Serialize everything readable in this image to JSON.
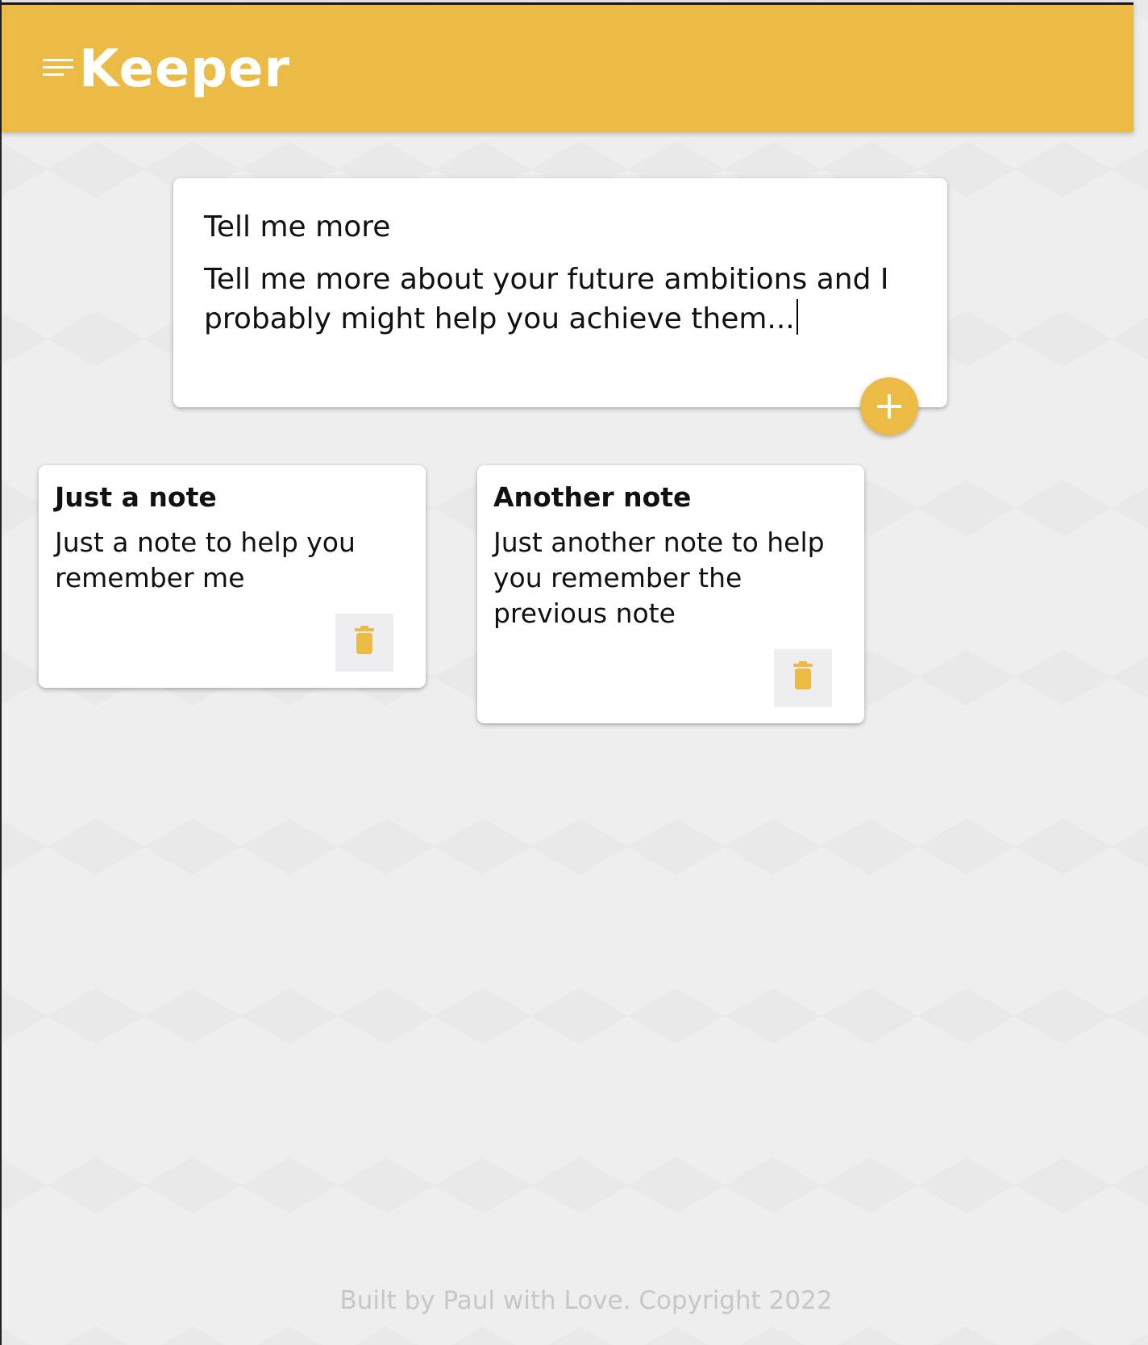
{
  "header": {
    "brand": "Keeper",
    "menu_icon": "menu-icon",
    "accent_color": "#ebbb46"
  },
  "composer": {
    "title": "Tell me more",
    "content": "Tell me more about your future ambitions and I probably might help you achieve them...",
    "add_icon": "plus-icon"
  },
  "notes": [
    {
      "title": "Just a note",
      "content": "Just a note to help you remember me",
      "delete_icon": "trash-icon"
    },
    {
      "title": "Another note",
      "content": "Just another note to help you remember the previous note",
      "delete_icon": "trash-icon"
    }
  ],
  "footer": {
    "text": "Built by Paul with Love. Copyright 2022"
  }
}
